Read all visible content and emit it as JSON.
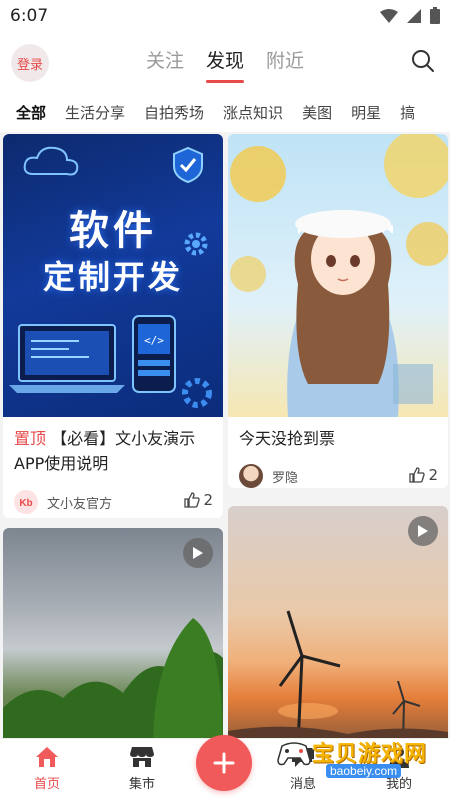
{
  "status_bar": {
    "time": "6:07",
    "icons": [
      "wifi-icon",
      "signal-icon",
      "battery-icon"
    ]
  },
  "header": {
    "login_label": "登录",
    "tabs": [
      {
        "label": "关注",
        "active": false
      },
      {
        "label": "发现",
        "active": true
      },
      {
        "label": "附近",
        "active": false
      }
    ],
    "search_icon": "search-icon"
  },
  "categories": {
    "items": [
      "全部",
      "生活分享",
      "自拍秀场",
      "涨点知识",
      "美图",
      "明星",
      "搞"
    ],
    "selected": "全部"
  },
  "feed": {
    "cards": [
      {
        "media": "poster",
        "poster_line1": "软件",
        "poster_line2": "定制开发",
        "pin_label": "置顶",
        "title": "【必看】文小友演示APP使用说明",
        "author": "文小友官方",
        "likes": "2"
      },
      {
        "media": "anime-girl-illustration",
        "title": "今天没抢到票",
        "author": "罗隐",
        "likes": "2"
      },
      {
        "media": "cloudy-sky-video",
        "has_play": true
      },
      {
        "media": "sunset-windmill-video",
        "has_play": true
      }
    ]
  },
  "bottom_nav": {
    "items": [
      {
        "label": "首页",
        "icon": "home-icon",
        "active": true
      },
      {
        "label": "集市",
        "icon": "store-icon",
        "active": false
      },
      {
        "label": "消息",
        "icon": "message-icon",
        "active": false
      },
      {
        "label": "我的",
        "icon": "profile-icon",
        "active": false
      }
    ],
    "fab_icon": "plus-icon"
  },
  "watermark": {
    "text": "宝贝游戏网",
    "url": "baobeiy.com"
  },
  "colors": {
    "accent": "#e84a4a",
    "background": "#f3f3f3"
  }
}
